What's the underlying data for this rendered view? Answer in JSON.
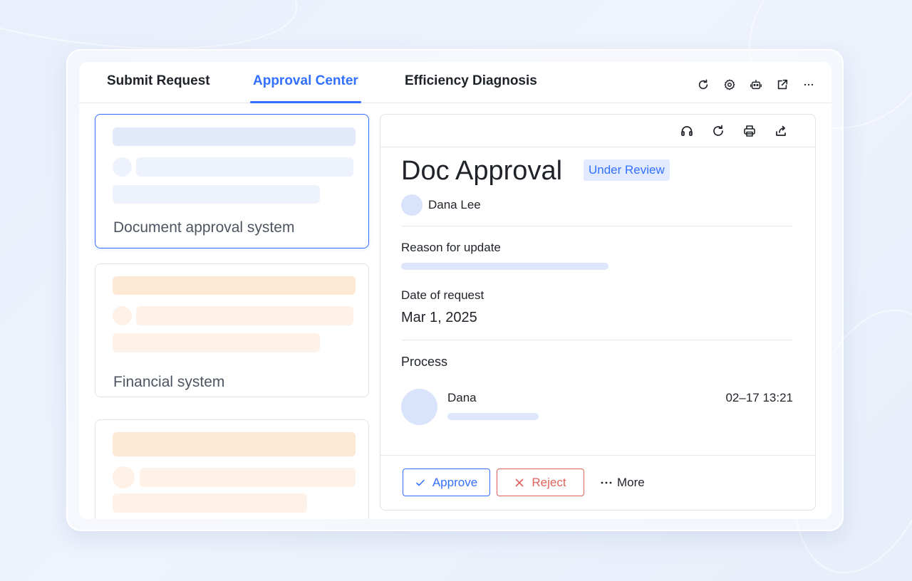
{
  "tabs": [
    {
      "label": "Submit Request",
      "active": false
    },
    {
      "label": "Approval Center",
      "active": true
    },
    {
      "label": "Efficiency Diagnosis",
      "active": false
    }
  ],
  "tab_icons": [
    "refresh-icon",
    "settings-icon",
    "bot-icon",
    "open-external-icon",
    "more-icon"
  ],
  "cards": [
    {
      "title": "Document approval system",
      "selected": true,
      "theme": "blue"
    },
    {
      "title": "Financial system",
      "selected": false,
      "theme": "orange"
    },
    {
      "title": "",
      "selected": false,
      "theme": "orange"
    }
  ],
  "detail": {
    "toolbar_icons": [
      "headset-icon",
      "refresh-icon",
      "print-icon",
      "share-icon"
    ],
    "title": "Doc Approval",
    "status": "Under Review",
    "author": "Dana Lee",
    "reason_label": "Reason for update",
    "date_label": "Date of request",
    "date_value": "Mar 1, 2025",
    "process_label": "Process",
    "process_step": {
      "name": "Dana",
      "time": "02–17 13:21"
    }
  },
  "actions": {
    "approve": "Approve",
    "reject": "Reject",
    "more": "More"
  },
  "colors": {
    "accent": "#3370ff",
    "reject": "#e0625a",
    "badge_bg": "#e1eaff",
    "placeholder_blue": "#e1e9fb",
    "placeholder_orange": "#fde8d4"
  }
}
